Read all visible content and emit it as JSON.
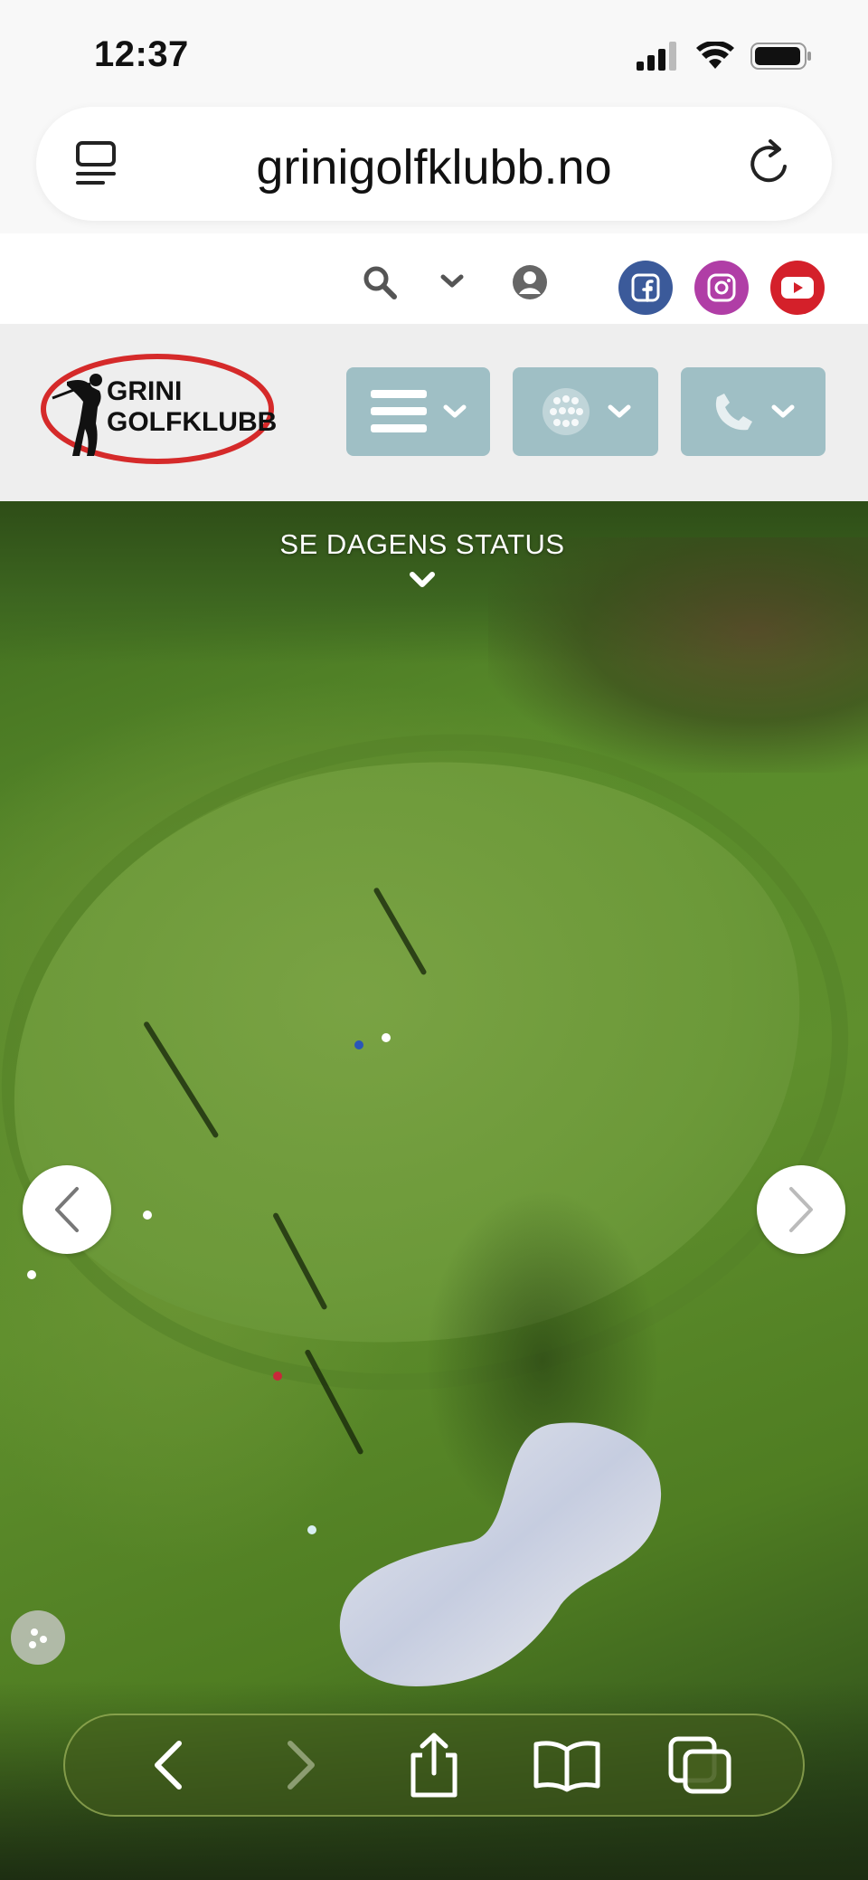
{
  "status_bar": {
    "time": "12:37"
  },
  "browser": {
    "url": "grinigolfklubb.no"
  },
  "utility_bar": {
    "icons": [
      "search-icon",
      "chevron-down-icon",
      "user-icon"
    ],
    "social": [
      {
        "name": "facebook",
        "color": "#3b5a9a"
      },
      {
        "name": "instagram",
        "color": "#b03ea6"
      },
      {
        "name": "youtube",
        "color": "#d4202a"
      }
    ]
  },
  "header": {
    "logo": {
      "line1": "GRINI",
      "line2": "GOLFKLUBB",
      "ring_color": "#d52a2a"
    },
    "nav_color": "#9fbfc5"
  },
  "hero": {
    "status_label": "SE DAGENS STATUS"
  },
  "toolbar": {
    "items": [
      "back-icon",
      "forward-icon",
      "share-icon",
      "bookmarks-icon",
      "tabs-icon"
    ]
  }
}
